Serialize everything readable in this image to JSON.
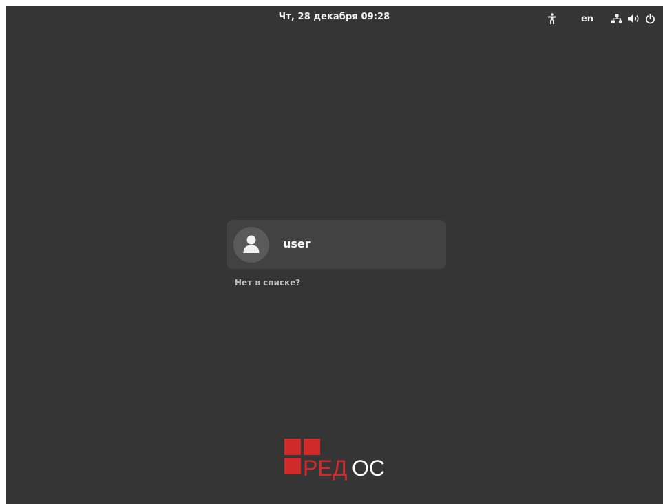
{
  "topbar": {
    "datetime": "Чт, 28 декабря  09:28",
    "language": "en",
    "icons": {
      "accessibility": "accessibility-icon",
      "network": "network-wired-icon",
      "volume": "volume-icon",
      "power": "power-icon"
    }
  },
  "login": {
    "user": {
      "name": "user",
      "avatar_icon": "user-avatar-icon"
    },
    "not_listed_label": "Нет в списке?"
  },
  "logo": {
    "text_part1": "РЕД",
    "text_part2": "ОС",
    "colors": {
      "red": "#d12a2a",
      "white": "#ffffff"
    }
  },
  "colors": {
    "background": "#353535",
    "card": "#424242",
    "text": "#f2f2f2"
  }
}
